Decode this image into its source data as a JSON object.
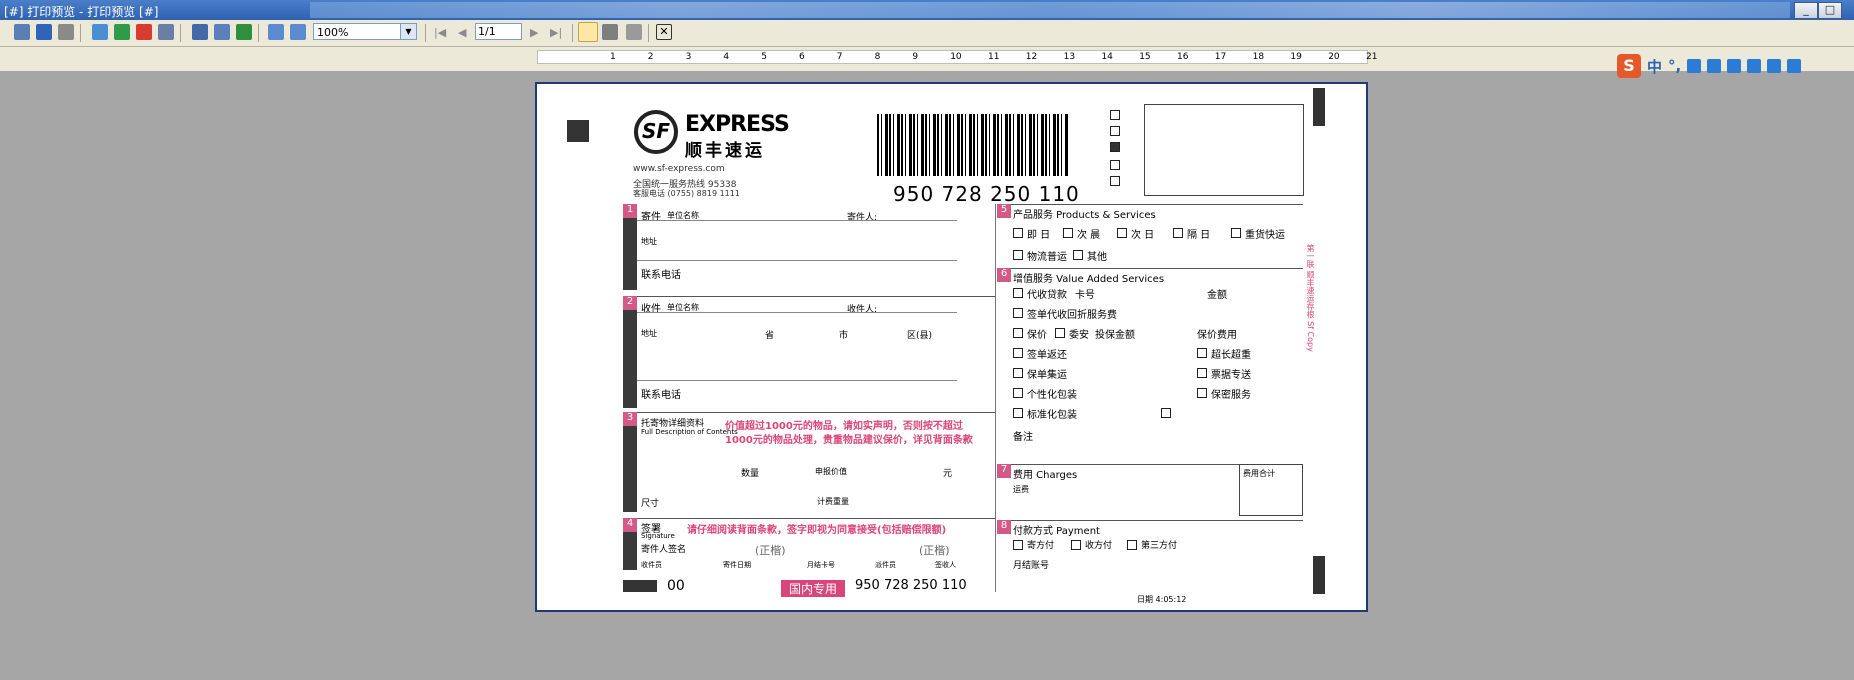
{
  "window": {
    "title": "[#] 打印预览 - 打印预览 [#]"
  },
  "toolbar": {
    "zoom_value": "100%",
    "page_value": "1/1"
  },
  "ruler": {
    "numbers": [
      "1",
      "2",
      "3",
      "4",
      "5",
      "6",
      "7",
      "8",
      "9",
      "10",
      "11",
      "12",
      "13",
      "14",
      "15",
      "16",
      "17",
      "18",
      "19",
      "20",
      "21"
    ]
  },
  "ime": {
    "logo": "S",
    "mode": "中",
    "punct": "°,"
  },
  "waybill": {
    "brand_en": "EXPRESS",
    "brand_cn": "顺丰速运",
    "website": "www.sf-express.com",
    "hotline": "全国统一服务热线 95338",
    "hotline2": "客服电话 (0755) 8819 1111",
    "tracking_number": "950 728 250 110",
    "sections": {
      "s1_title": "寄件",
      "s1_company": "单位名称",
      "s1_sender": "寄件人:",
      "s1_address": "地址",
      "s1_phone": "联系电话",
      "s2_title": "收件",
      "s2_company": "单位名称",
      "s2_receiver": "收件人:",
      "s2_address": "地址",
      "s2_province": "省",
      "s2_city": "市",
      "s2_district": "区(县)",
      "s2_phone": "联系电话",
      "s3_title": "托寄物详细资料",
      "s3_title_en": "Full Description of Contents",
      "s3_warning1": "价值超过1000元的物品，请如实声明，否则按不超过",
      "s3_warning2": "1000元的物品处理，贵重物品建议保价，详见背面条款",
      "s3_qty": "数量",
      "s3_value": "申报价值",
      "s3_unit": "元",
      "s3_size": "尺寸",
      "s3_weight": "计费重量",
      "s4_title": "签署",
      "s4_title_en": "Signature",
      "s4_warning": "请仔细阅读背面条款，签字即视为同意接受(包括赔偿限额)",
      "s4_sender_sign": "寄件人签名",
      "s4_stamp1": "(正楷)",
      "s4_stamp2": "(正楷)",
      "domestic_tag": "国内专用",
      "code_00": "00",
      "s5_title": "产品服务 Products & Services",
      "s5_opt1": "即 日",
      "s5_opt2": "次 晨",
      "s5_opt3": "次 日",
      "s5_opt4": "隔 日",
      "s5_opt5": "重货快运",
      "s5_opt6": "物流普运",
      "s5_opt7": "其他",
      "s6_title": "增值服务 Value Added Services",
      "s6_cod": "代收贷款",
      "s6_card": "卡号",
      "s6_amount": "金额",
      "s6_sign": "签单代收回折服务费",
      "s6_insure": "保价",
      "s6_safe": "委安",
      "s6_insure_amt": "投保金额",
      "s6_insure_fee": "保价费用",
      "s6_return": "签单返还",
      "s6_long": "超长超重",
      "s6_collect": "保单集运",
      "s6_special": "票据专送",
      "s6_custom": "个性化包装",
      "s6_secret": "保密服务",
      "s6_standard": "标准化包装",
      "s6_note": "备注",
      "s7_title": "费用 Charges",
      "s7_freight": "运费",
      "s7_total": "费用合计",
      "s8_title": "付款方式 Payment",
      "s8_sender": "寄方付",
      "s8_receiver": "收方付",
      "s8_third": "第三方付",
      "s8_monthly": "月结账号",
      "side_text": "第一联 顺丰速运存根 Sf Copy",
      "footer1": "收件员",
      "footer2": "寄件日期",
      "footer3": "月结卡号",
      "footer4": "派件员",
      "footer5": "签收人",
      "printed_date": "日期 4:05:12"
    }
  }
}
